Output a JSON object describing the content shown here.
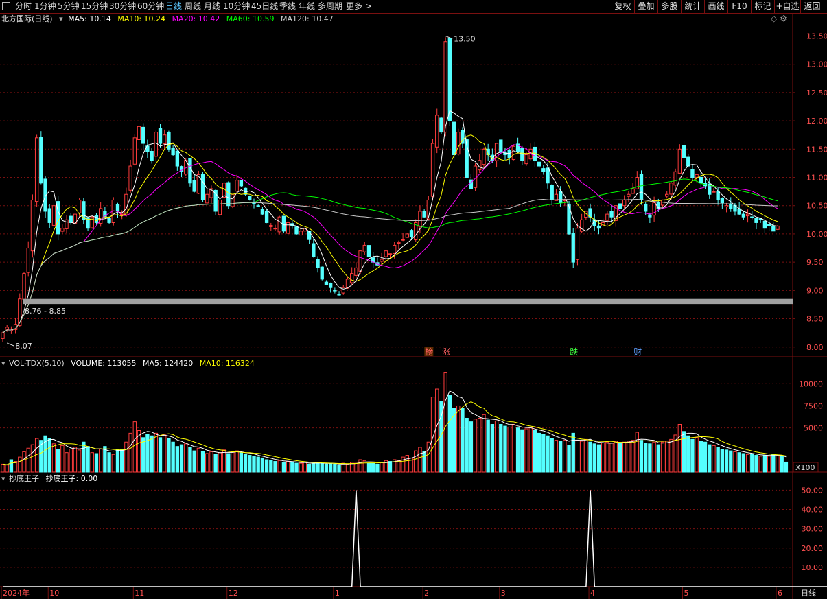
{
  "toolbar": {
    "periods": [
      "分时",
      "1分钟",
      "5分钟",
      "15分钟",
      "30分钟",
      "60分钟",
      "日线",
      "周线",
      "月线",
      "10分钟",
      "45日线",
      "季线",
      "年线",
      "多周期",
      "更多 >"
    ],
    "active": "日线",
    "right_buttons": [
      "复权",
      "叠加",
      "多股",
      "统计",
      "画线",
      "F10",
      "标记",
      "+自选",
      "返回"
    ]
  },
  "main_legend": {
    "title": "北方国际(日线)",
    "ma5": "MA5: 10.14",
    "ma10": "MA10: 10.24",
    "ma20": "MA20: 10.42",
    "ma60": "MA60: 10.59",
    "ma120": "MA120: 10.47"
  },
  "vol_legend": {
    "title": "VOL-TDX(5,10)",
    "volume": "VOLUME: 113055",
    "ma5": "MA5: 124420",
    "ma10": "MA10: 116324"
  },
  "ind_legend": {
    "title": "抄底王子",
    "value": "抄底王子: 0.00"
  },
  "colors": {
    "up": "#ff3c3c",
    "down": "#54ffff",
    "ma5": "#ffffff",
    "ma10": "#ffff00",
    "ma20": "#ff00ff",
    "ma60": "#00ff00",
    "ma120": "#c8c8c8",
    "grid": "#7a1010"
  },
  "annotations": {
    "high": "13.50",
    "low": "8.07",
    "band": "8.76 - 8.85",
    "marker_1": "榜",
    "marker_2": "涨",
    "marker_3": "跌",
    "marker_4": "财"
  },
  "volume_unit": "X100",
  "bottom_right": "日线",
  "chart_data": [
    {
      "type": "candlestick",
      "title": "北方国际(日线)",
      "y_ticks": [
        "13.50",
        "13.00",
        "12.50",
        "12.00",
        "11.50",
        "11.00",
        "10.50",
        "10.00",
        "9.50",
        "9.00",
        "8.50",
        "8.00"
      ],
      "x_ticks": [
        "2024年",
        "10",
        "11",
        "12",
        "1",
        "2",
        "3",
        "4",
        "5",
        "6"
      ],
      "ylim": [
        7.9,
        13.7
      ],
      "range_high": 13.5,
      "range_low": 8.07,
      "band": [
        8.76,
        8.85
      ],
      "closes": [
        8.25,
        8.35,
        8.3,
        8.4,
        8.85,
        9.3,
        9.75,
        10.6,
        11.7,
        10.9,
        10.4,
        10.2,
        10.5,
        10.0,
        10.1,
        10.25,
        10.2,
        10.35,
        10.6,
        10.25,
        10.1,
        10.3,
        10.2,
        10.45,
        10.3,
        10.2,
        10.6,
        10.4,
        10.35,
        10.7,
        11.2,
        11.7,
        11.9,
        11.6,
        11.45,
        11.3,
        11.8,
        11.6,
        11.75,
        11.5,
        11.4,
        11.2,
        11.1,
        11.3,
        10.9,
        10.75,
        11.05,
        10.6,
        10.7,
        10.8,
        10.4,
        10.6,
        10.9,
        10.5,
        10.7,
        10.95,
        10.85,
        10.7,
        10.6,
        10.55,
        10.5,
        10.35,
        10.2,
        10.15,
        10.1,
        10.3,
        10.05,
        10.2,
        10.15,
        10.0,
        10.05,
        10.1,
        9.9,
        9.6,
        9.4,
        9.2,
        9.1,
        9.05,
        9.0,
        8.92,
        9.05,
        9.2,
        9.3,
        9.4,
        9.7,
        9.8,
        9.6,
        9.5,
        9.45,
        9.55,
        9.7,
        9.65,
        9.8,
        9.85,
        9.9,
        10.0,
        9.95,
        10.2,
        10.4,
        10.3,
        10.6,
        11.6,
        12.1,
        11.8,
        13.4,
        12.0,
        11.4,
        11.8,
        11.6,
        11.0,
        10.8,
        11.2,
        11.3,
        11.5,
        11.4,
        11.3,
        11.6,
        11.45,
        11.4,
        11.35,
        11.55,
        11.45,
        11.3,
        11.4,
        11.5,
        11.3,
        11.2,
        11.1,
        10.9,
        10.6,
        10.7,
        10.55,
        10.6,
        10.0,
        9.5,
        10.1,
        10.25,
        10.4,
        10.3,
        10.15,
        10.1,
        10.2,
        10.35,
        10.3,
        10.5,
        10.45,
        10.6,
        10.7,
        10.8,
        11.0,
        10.6,
        10.4,
        10.3,
        10.55,
        10.45,
        10.6,
        10.7,
        10.9,
        11.1,
        11.5,
        11.35,
        11.2,
        11.0,
        11.05,
        10.9,
        10.85,
        10.7,
        10.75,
        10.6,
        10.55,
        10.5,
        10.45,
        10.4,
        10.35,
        10.3,
        10.35,
        10.3,
        10.2,
        10.25,
        10.1,
        10.15,
        10.05,
        10.14
      ]
    },
    {
      "type": "bar",
      "title": "VOL-TDX(5,10)",
      "y_ticks": [
        "10000",
        "7500",
        "5000"
      ],
      "ylim": [
        0,
        11500
      ],
      "values": [
        900,
        800,
        1400,
        1200,
        1700,
        2300,
        2700,
        3100,
        3800,
        3600,
        4100,
        3800,
        3200,
        2600,
        3000,
        2200,
        2600,
        2800,
        2500,
        3400,
        2900,
        2200,
        2100,
        2600,
        2900,
        2200,
        2000,
        2500,
        2600,
        3400,
        4400,
        5700,
        4700,
        3900,
        4300,
        4100,
        4400,
        3900,
        4200,
        3800,
        3400,
        2900,
        3100,
        3200,
        2800,
        2400,
        2700,
        2300,
        2100,
        2300,
        2000,
        2200,
        2500,
        2100,
        2300,
        2400,
        2200,
        2000,
        1900,
        1800,
        1700,
        1600,
        1400,
        1300,
        1200,
        1300,
        1100,
        1200,
        1100,
        1000,
        1000,
        1100,
        900,
        1000,
        1100,
        1000,
        900,
        1000,
        900,
        800,
        1000,
        900,
        1100,
        1000,
        1400,
        1300,
        1000,
        1000,
        900,
        1100,
        1300,
        1200,
        1400,
        1300,
        1700,
        1900,
        1600,
        2400,
        2800,
        2300,
        3400,
        8500,
        9400,
        8000,
        11300,
        8700,
        7200,
        7500,
        7200,
        6100,
        5700,
        6000,
        6100,
        6500,
        5900,
        5400,
        5800,
        5400,
        5200,
        5100,
        5400,
        5000,
        4800,
        4900,
        5000,
        4700,
        4400,
        4300,
        4100,
        3800,
        3600,
        3500,
        3600,
        3000,
        4400,
        3600,
        3500,
        3700,
        3400,
        3200,
        3100,
        3300,
        3400,
        3300,
        3500,
        3300,
        3400,
        3500,
        3600,
        4500,
        3600,
        3300,
        3200,
        3400,
        3100,
        3400,
        3500,
        3700,
        4200,
        5400,
        4600,
        4100,
        3700,
        3900,
        3500,
        3400,
        3100,
        3000,
        2800,
        2600,
        2500,
        2400,
        2300,
        2200,
        2100,
        2000,
        2000,
        1900,
        1800,
        1900,
        1800,
        2000,
        1900,
        1800,
        1130
      ]
    },
    {
      "type": "line",
      "title": "抄底王子",
      "y_ticks": [
        "50.00",
        "40.00",
        "30.00",
        "20.00",
        "10.00"
      ],
      "ylim": [
        0,
        53
      ],
      "values": [
        0,
        0,
        0,
        0,
        0,
        0,
        0,
        0,
        0,
        0,
        0,
        0,
        0,
        0,
        0,
        0,
        0,
        0,
        0,
        0,
        0,
        0,
        0,
        0,
        0,
        0,
        0,
        0,
        0,
        0,
        0,
        0,
        0,
        0,
        0,
        0,
        0,
        0,
        0,
        0,
        0,
        0,
        0,
        0,
        0,
        0,
        0,
        0,
        0,
        0,
        0,
        0,
        0,
        0,
        0,
        0,
        0,
        0,
        0,
        0,
        0,
        0,
        0,
        0,
        0,
        0,
        0,
        0,
        0,
        0,
        0,
        0,
        0,
        0,
        0,
        0,
        0,
        0,
        0,
        0,
        0,
        0,
        0,
        50,
        0,
        0,
        0,
        0,
        0,
        0,
        0,
        0,
        0,
        0,
        0,
        0,
        0,
        0,
        0,
        0,
        0,
        0,
        0,
        0,
        0,
        0,
        0,
        0,
        0,
        0,
        0,
        0,
        0,
        0,
        0,
        0,
        0,
        0,
        0,
        0,
        0,
        0,
        0,
        0,
        0,
        0,
        0,
        0,
        0,
        0,
        0,
        0,
        0,
        0,
        0,
        0,
        0,
        0,
        50,
        0,
        0,
        0,
        0,
        0,
        0,
        0,
        0,
        0,
        0,
        0,
        0,
        0,
        0,
        0,
        0,
        0,
        0,
        0,
        0,
        0,
        0,
        0,
        0,
        0,
        0,
        0,
        0,
        0,
        0,
        0,
        0,
        0,
        0,
        0,
        0,
        0,
        0,
        0,
        0,
        0,
        0,
        0,
        0,
        0,
        0,
        0,
        0,
        0,
        0,
        0,
        0,
        0,
        0,
        0,
        0,
        0
      ]
    }
  ]
}
